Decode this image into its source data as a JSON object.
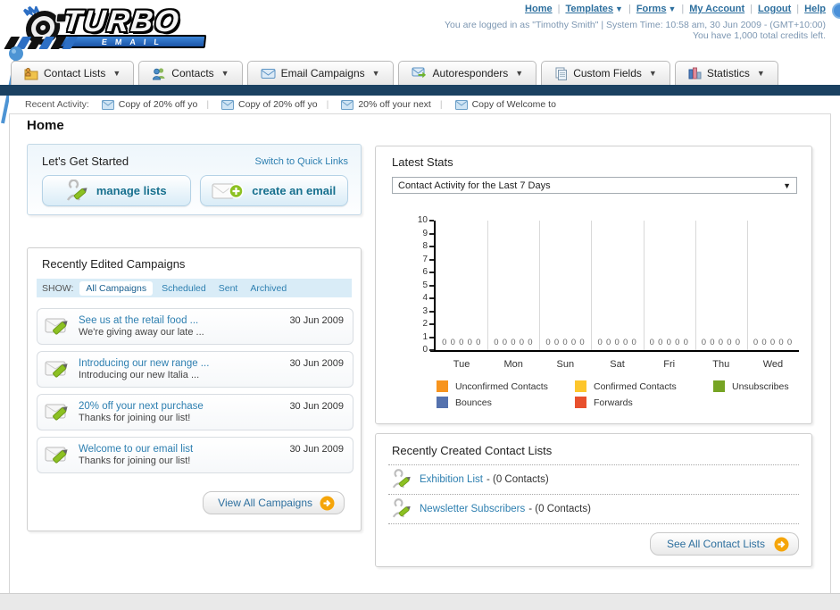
{
  "header": {
    "logo": {
      "word": "TURBO",
      "sub": "EMAIL"
    },
    "links": [
      "Home",
      "Templates",
      "Forms",
      "My Account",
      "Logout",
      "Help"
    ],
    "separator": "|",
    "login_text": "You are logged in as \"Timothy Smith\" | System Time: 10:58 am, 30 Jun 2009 - (GMT+10:00)",
    "credits_text": "You have 1,000 total credits left."
  },
  "nav": {
    "tabs": [
      {
        "label": "Contact Lists"
      },
      {
        "label": "Contacts"
      },
      {
        "label": "Email Campaigns"
      },
      {
        "label": "Autoresponders"
      },
      {
        "label": "Custom Fields"
      },
      {
        "label": "Statistics"
      }
    ]
  },
  "recent_activity": {
    "label": "Recent Activity:",
    "separator": "|",
    "items": [
      "Copy of 20% off yo",
      "Copy of 20% off yo",
      "20% off your next",
      "Copy of Welcome to"
    ]
  },
  "page": {
    "title": "Home"
  },
  "get_started": {
    "title": "Let's Get Started",
    "switch_link": "Switch to Quick Links",
    "manage_lists_label": "manage lists",
    "create_email_label": "create an email"
  },
  "campaigns": {
    "title": "Recently Edited Campaigns",
    "show_label": "SHOW:",
    "tabs": [
      "All Campaigns",
      "Scheduled",
      "Sent",
      "Archived"
    ],
    "active_tab": "All Campaigns",
    "items": [
      {
        "title": "See us at the retail food ...",
        "subtitle": "We're giving away our late ...",
        "date": "30 Jun 2009"
      },
      {
        "title": "Introducing our new range ...",
        "subtitle": "Introducing our new Italia ...",
        "date": "30 Jun 2009"
      },
      {
        "title": "20% off your next purchase",
        "subtitle": "Thanks for joining our list!",
        "date": "30 Jun 2009"
      },
      {
        "title": "Welcome to our email list",
        "subtitle": "Thanks for joining our list!",
        "date": "30 Jun 2009"
      }
    ],
    "view_all_label": "View All Campaigns"
  },
  "stats": {
    "title": "Latest Stats",
    "dropdown_value": "Contact Activity for the Last 7 Days"
  },
  "chart_data": {
    "type": "bar",
    "title": "Contact Activity for the Last 7 Days",
    "categories": [
      "Tue",
      "Mon",
      "Sun",
      "Sat",
      "Fri",
      "Thu",
      "Wed"
    ],
    "series": [
      {
        "name": "Unconfirmed Contacts",
        "color": "#f7941e",
        "values": [
          0,
          0,
          0,
          0,
          0,
          0,
          0
        ]
      },
      {
        "name": "Confirmed Contacts",
        "color": "#fdc62c",
        "values": [
          0,
          0,
          0,
          0,
          0,
          0,
          0
        ]
      },
      {
        "name": "Unsubscribes",
        "color": "#76a424",
        "values": [
          0,
          0,
          0,
          0,
          0,
          0,
          0
        ]
      },
      {
        "name": "Bounces",
        "color": "#5572ae",
        "values": [
          0,
          0,
          0,
          0,
          0,
          0,
          0
        ]
      },
      {
        "name": "Forwards",
        "color": "#e8502d",
        "values": [
          0,
          0,
          0,
          0,
          0,
          0,
          0
        ]
      }
    ],
    "xlabel": "",
    "ylabel": "",
    "ylim": [
      0,
      10
    ],
    "yticks": [
      0,
      1,
      2,
      3,
      4,
      5,
      6,
      7,
      8,
      9,
      10
    ],
    "grid": "vertical-group-separators",
    "value_labels": "0 shown above axis for every series in every group",
    "legend_position": "bottom"
  },
  "contact_lists": {
    "title": "Recently Created Contact Lists",
    "separator": "-",
    "items": [
      {
        "name": "Exhibition List",
        "count": "(0 Contacts)"
      },
      {
        "name": "Newsletter Subscribers",
        "count": "(0 Contacts)"
      }
    ],
    "see_all_label": "See All Contact Lists"
  },
  "colors": {
    "navy_bar": "#1b4161",
    "link_blue": "#2d7fb0",
    "button_text": "#17708e",
    "arrow_circle": "#f5a50a",
    "pin_blue": "#4d94d4"
  }
}
